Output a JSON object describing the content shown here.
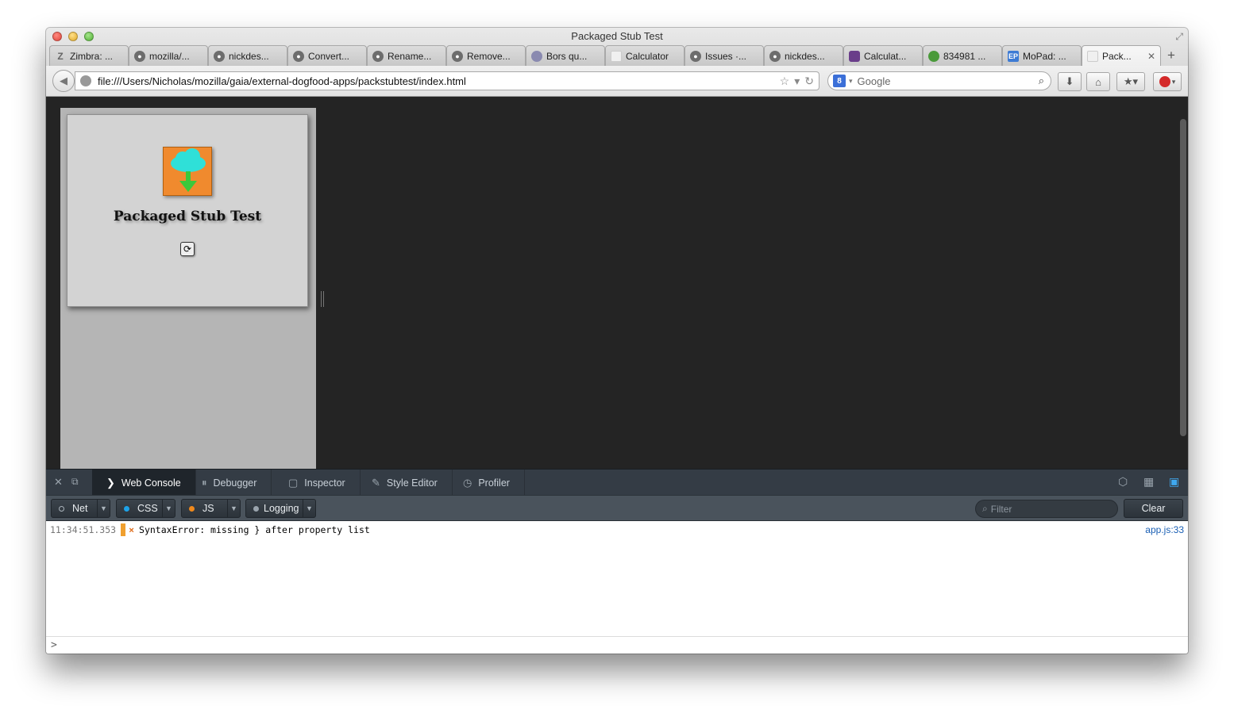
{
  "window": {
    "title": "Packaged Stub Test"
  },
  "tabs": [
    {
      "label": "Zimbra: ...",
      "icon": "zimbra-icon"
    },
    {
      "label": "mozilla/...",
      "icon": "github-icon"
    },
    {
      "label": "nickdes...",
      "icon": "github-icon"
    },
    {
      "label": "Convert...",
      "icon": "github-icon"
    },
    {
      "label": "Rename...",
      "icon": "github-icon"
    },
    {
      "label": "Remove...",
      "icon": "github-icon"
    },
    {
      "label": "Bors qu...",
      "icon": "bors-icon"
    },
    {
      "label": "Calculator",
      "icon": "blank-page-icon"
    },
    {
      "label": "Issues ·...",
      "icon": "github-icon"
    },
    {
      "label": "nickdes...",
      "icon": "github-icon"
    },
    {
      "label": "Calculat...",
      "icon": "calculator-icon"
    },
    {
      "label": "834981 ...",
      "icon": "bug-icon"
    },
    {
      "label": "MoPad: ...",
      "icon": "etherpad-icon"
    },
    {
      "label": "Pack...",
      "icon": "blank-page-icon",
      "active": true
    }
  ],
  "navbar": {
    "url": "file:///Users/Nicholas/mozilla/gaia/external-dogfood-apps/packstubtest/index.html",
    "search_placeholder": "Google"
  },
  "app": {
    "title": "Packaged Stub Test",
    "icon": "cloud-download-icon"
  },
  "devtools": {
    "tabs": [
      {
        "label": "Web Console",
        "icon": "console-icon",
        "active": true
      },
      {
        "label": "Debugger",
        "icon": "pause-icon"
      },
      {
        "label": "Inspector",
        "icon": "inspector-icon"
      },
      {
        "label": "Style Editor",
        "icon": "edit-icon"
      },
      {
        "label": "Profiler",
        "icon": "clock-icon"
      }
    ],
    "filters": [
      {
        "label": "Net",
        "color": "#2c333a"
      },
      {
        "label": "CSS",
        "color": "#1da2e8"
      },
      {
        "label": "JS",
        "color": "#f0891c"
      },
      {
        "label": "Logging",
        "color": "#9aa4ad"
      }
    ],
    "filter_placeholder": "Filter",
    "clear_label": "Clear",
    "messages": [
      {
        "timestamp": "11:34:51.353",
        "text": "SyntaxError: missing } after property list",
        "location": "app.js:33"
      }
    ],
    "prompt": ">"
  }
}
